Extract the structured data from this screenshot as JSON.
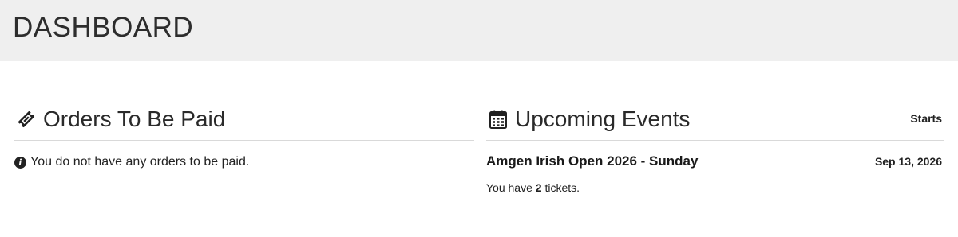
{
  "header": {
    "title": "DASHBOARD"
  },
  "orders": {
    "title": "Orders To Be Paid",
    "icon": "ticket-icon",
    "empty_message": "You do not have any orders to be paid.",
    "empty_icon": "info-icon"
  },
  "events": {
    "title": "Upcoming Events",
    "icon": "calendar-icon",
    "column_header": "Starts",
    "items": [
      {
        "name": "Amgen Irish Open 2026 - Sunday",
        "date": "Sep 13, 2026",
        "tickets_prefix": "You have ",
        "tickets_count": "2",
        "tickets_suffix": " tickets."
      }
    ]
  }
}
